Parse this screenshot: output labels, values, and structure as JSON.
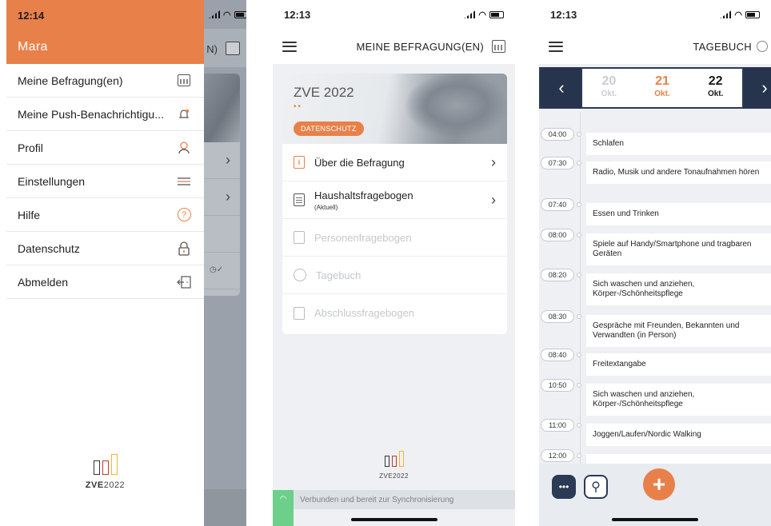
{
  "colors": {
    "accent": "#e8804a",
    "navy": "#2b3a55",
    "sync_green": "#6ccf8a"
  },
  "phone1": {
    "time": "12:14",
    "user_name": "Mara",
    "bg_title_fragment": "N)",
    "menu": [
      {
        "label": "Meine Befragung(en)",
        "icon": "calendar-icon"
      },
      {
        "label": "Meine Push-Benachrichtigu...",
        "icon": "bell-icon"
      },
      {
        "label": "Profil",
        "icon": "user-icon"
      },
      {
        "label": "Einstellungen",
        "icon": "settings-lines-icon"
      },
      {
        "label": "Hilfe",
        "icon": "help-icon"
      },
      {
        "label": "Datenschutz",
        "icon": "lock-icon"
      },
      {
        "label": "Abmelden",
        "icon": "logout-icon"
      }
    ],
    "logo": {
      "prefix": "ZVE",
      "year": "2022"
    }
  },
  "phone2": {
    "time": "12:13",
    "title": "MEINE BEFRAGUNG(EN)",
    "survey_title": "ZVE 2022",
    "badge": "DATENSCHUTZ",
    "rows": [
      {
        "label": "Über die Befragung",
        "sub": "",
        "active": true
      },
      {
        "label": "Haushaltsfragebogen",
        "sub": "(Aktuell)",
        "active": true
      },
      {
        "label": "Personenfragebogen",
        "sub": "",
        "active": false
      },
      {
        "label": "Tagebuch",
        "sub": "",
        "active": false
      },
      {
        "label": "Abschlussfragebogen",
        "sub": "",
        "active": false
      }
    ],
    "logo": "ZVE2022",
    "sync_status": "Verbunden und bereit zur Synchronisierung"
  },
  "phone3": {
    "time": "12:13",
    "title": "TAGEBUCH",
    "dates": [
      {
        "day": "20",
        "month": "Okt."
      },
      {
        "day": "21",
        "month": "Okt."
      },
      {
        "day": "22",
        "month": "Okt."
      }
    ],
    "entries": [
      {
        "time": "04:00",
        "activity": "Schlafen"
      },
      {
        "time": "07:30",
        "activity": "Radio, Musik und andere Tonaufnahmen hören"
      },
      {
        "time": "07:40",
        "activity": "Essen und Trinken"
      },
      {
        "time": "08:00",
        "activity": "Spiele auf Handy/Smartphone und tragbaren Geräten"
      },
      {
        "time": "08:20",
        "activity": "Sich waschen und anziehen, Körper-/Schönheitspflege"
      },
      {
        "time": "08:30",
        "activity": "Gespräche mit Freunden, Bekannten und Verwandten (in Person)"
      },
      {
        "time": "08:40",
        "activity": "Freitextangabe"
      },
      {
        "time": "10:50",
        "activity": "Sich waschen und anziehen, Körper-/Schönheitspflege"
      },
      {
        "time": "11:00",
        "activity": "Joggen/Laufen/Nordic Walking"
      },
      {
        "time": "12:00",
        "activity": ""
      }
    ]
  }
}
